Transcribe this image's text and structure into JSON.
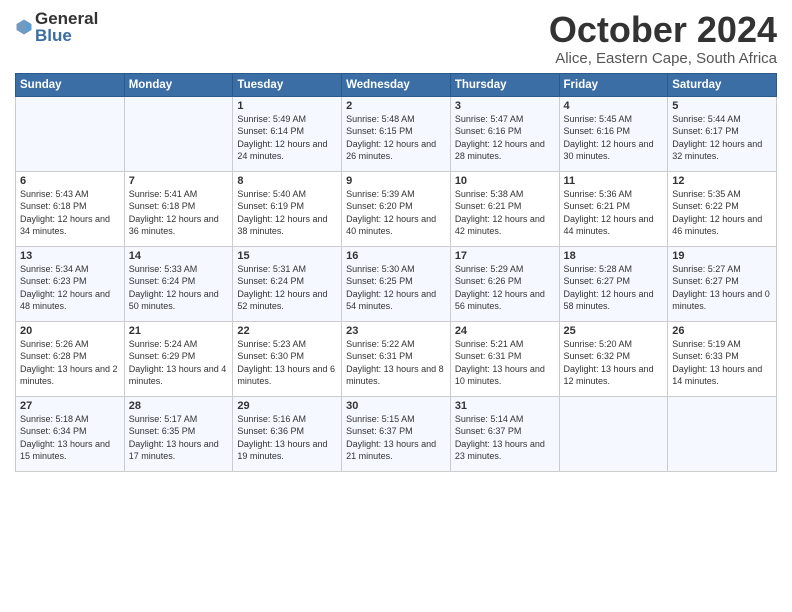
{
  "logo": {
    "line1": "General",
    "line2": "Blue"
  },
  "title": "October 2024",
  "location": "Alice, Eastern Cape, South Africa",
  "days_header": [
    "Sunday",
    "Monday",
    "Tuesday",
    "Wednesday",
    "Thursday",
    "Friday",
    "Saturday"
  ],
  "weeks": [
    [
      {
        "num": "",
        "detail": ""
      },
      {
        "num": "",
        "detail": ""
      },
      {
        "num": "1",
        "detail": "Sunrise: 5:49 AM\nSunset: 6:14 PM\nDaylight: 12 hours\nand 24 minutes."
      },
      {
        "num": "2",
        "detail": "Sunrise: 5:48 AM\nSunset: 6:15 PM\nDaylight: 12 hours\nand 26 minutes."
      },
      {
        "num": "3",
        "detail": "Sunrise: 5:47 AM\nSunset: 6:16 PM\nDaylight: 12 hours\nand 28 minutes."
      },
      {
        "num": "4",
        "detail": "Sunrise: 5:45 AM\nSunset: 6:16 PM\nDaylight: 12 hours\nand 30 minutes."
      },
      {
        "num": "5",
        "detail": "Sunrise: 5:44 AM\nSunset: 6:17 PM\nDaylight: 12 hours\nand 32 minutes."
      }
    ],
    [
      {
        "num": "6",
        "detail": "Sunrise: 5:43 AM\nSunset: 6:18 PM\nDaylight: 12 hours\nand 34 minutes."
      },
      {
        "num": "7",
        "detail": "Sunrise: 5:41 AM\nSunset: 6:18 PM\nDaylight: 12 hours\nand 36 minutes."
      },
      {
        "num": "8",
        "detail": "Sunrise: 5:40 AM\nSunset: 6:19 PM\nDaylight: 12 hours\nand 38 minutes."
      },
      {
        "num": "9",
        "detail": "Sunrise: 5:39 AM\nSunset: 6:20 PM\nDaylight: 12 hours\nand 40 minutes."
      },
      {
        "num": "10",
        "detail": "Sunrise: 5:38 AM\nSunset: 6:21 PM\nDaylight: 12 hours\nand 42 minutes."
      },
      {
        "num": "11",
        "detail": "Sunrise: 5:36 AM\nSunset: 6:21 PM\nDaylight: 12 hours\nand 44 minutes."
      },
      {
        "num": "12",
        "detail": "Sunrise: 5:35 AM\nSunset: 6:22 PM\nDaylight: 12 hours\nand 46 minutes."
      }
    ],
    [
      {
        "num": "13",
        "detail": "Sunrise: 5:34 AM\nSunset: 6:23 PM\nDaylight: 12 hours\nand 48 minutes."
      },
      {
        "num": "14",
        "detail": "Sunrise: 5:33 AM\nSunset: 6:24 PM\nDaylight: 12 hours\nand 50 minutes."
      },
      {
        "num": "15",
        "detail": "Sunrise: 5:31 AM\nSunset: 6:24 PM\nDaylight: 12 hours\nand 52 minutes."
      },
      {
        "num": "16",
        "detail": "Sunrise: 5:30 AM\nSunset: 6:25 PM\nDaylight: 12 hours\nand 54 minutes."
      },
      {
        "num": "17",
        "detail": "Sunrise: 5:29 AM\nSunset: 6:26 PM\nDaylight: 12 hours\nand 56 minutes."
      },
      {
        "num": "18",
        "detail": "Sunrise: 5:28 AM\nSunset: 6:27 PM\nDaylight: 12 hours\nand 58 minutes."
      },
      {
        "num": "19",
        "detail": "Sunrise: 5:27 AM\nSunset: 6:27 PM\nDaylight: 13 hours\nand 0 minutes."
      }
    ],
    [
      {
        "num": "20",
        "detail": "Sunrise: 5:26 AM\nSunset: 6:28 PM\nDaylight: 13 hours\nand 2 minutes."
      },
      {
        "num": "21",
        "detail": "Sunrise: 5:24 AM\nSunset: 6:29 PM\nDaylight: 13 hours\nand 4 minutes."
      },
      {
        "num": "22",
        "detail": "Sunrise: 5:23 AM\nSunset: 6:30 PM\nDaylight: 13 hours\nand 6 minutes."
      },
      {
        "num": "23",
        "detail": "Sunrise: 5:22 AM\nSunset: 6:31 PM\nDaylight: 13 hours\nand 8 minutes."
      },
      {
        "num": "24",
        "detail": "Sunrise: 5:21 AM\nSunset: 6:31 PM\nDaylight: 13 hours\nand 10 minutes."
      },
      {
        "num": "25",
        "detail": "Sunrise: 5:20 AM\nSunset: 6:32 PM\nDaylight: 13 hours\nand 12 minutes."
      },
      {
        "num": "26",
        "detail": "Sunrise: 5:19 AM\nSunset: 6:33 PM\nDaylight: 13 hours\nand 14 minutes."
      }
    ],
    [
      {
        "num": "27",
        "detail": "Sunrise: 5:18 AM\nSunset: 6:34 PM\nDaylight: 13 hours\nand 15 minutes."
      },
      {
        "num": "28",
        "detail": "Sunrise: 5:17 AM\nSunset: 6:35 PM\nDaylight: 13 hours\nand 17 minutes."
      },
      {
        "num": "29",
        "detail": "Sunrise: 5:16 AM\nSunset: 6:36 PM\nDaylight: 13 hours\nand 19 minutes."
      },
      {
        "num": "30",
        "detail": "Sunrise: 5:15 AM\nSunset: 6:37 PM\nDaylight: 13 hours\nand 21 minutes."
      },
      {
        "num": "31",
        "detail": "Sunrise: 5:14 AM\nSunset: 6:37 PM\nDaylight: 13 hours\nand 23 minutes."
      },
      {
        "num": "",
        "detail": ""
      },
      {
        "num": "",
        "detail": ""
      }
    ]
  ]
}
